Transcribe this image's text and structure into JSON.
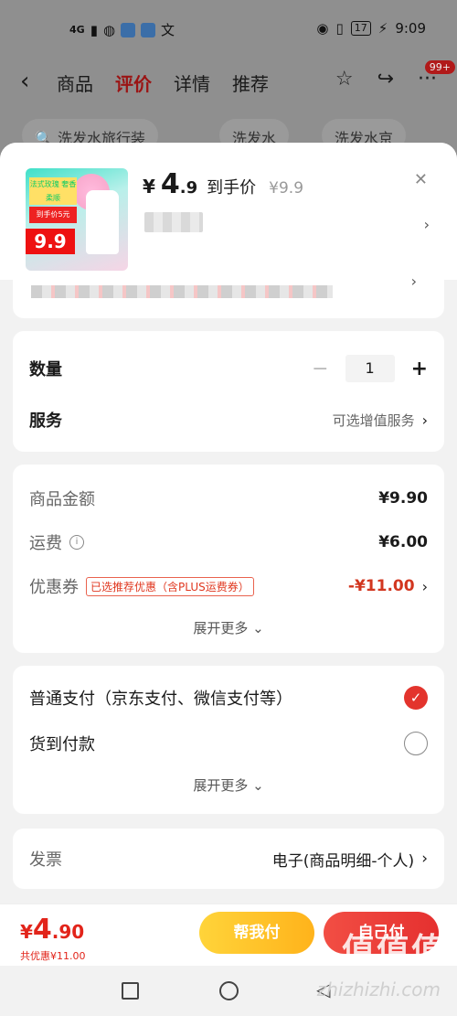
{
  "statusbar": {
    "net": "4G",
    "time": "9:09",
    "battery": "17"
  },
  "topnav": {
    "back": "‹",
    "tabs": [
      "商品",
      "评价",
      "详情",
      "推荐"
    ],
    "active_tab": "评价",
    "badge": "99+"
  },
  "search_chips": [
    "洗发水旅行装",
    "洗发水",
    "洗发水京"
  ],
  "product": {
    "currency": "¥",
    "price_int": "4",
    "price_dec": ".9",
    "price_label": "到手价",
    "original_price": "¥9.9",
    "thumb_price": "9.9",
    "thumb_tag1": "法式玫瑰 奢香柔顺",
    "thumb_tag2": "到手价5元"
  },
  "quantity": {
    "label": "数量",
    "value": "1"
  },
  "service": {
    "label": "服务",
    "value": "可选增值服务"
  },
  "summary": {
    "goods_label": "商品金额",
    "goods_value": "¥9.90",
    "shipping_label": "运费",
    "shipping_value": "¥6.00",
    "coupon_label": "优惠券",
    "coupon_tag": "已选推荐优惠（含PLUS运费券）",
    "coupon_value": "-¥11.00",
    "more": "展开更多"
  },
  "payment": {
    "option1": "普通支付（京东支付、微信支付等）",
    "option2": "货到付款",
    "more": "展开更多"
  },
  "invoice": {
    "label": "发票",
    "value": "电子(商品明细-个人)"
  },
  "bottombar": {
    "currency": "¥",
    "total_int": "4",
    "total_dec": ".90",
    "saved": "共优惠¥11.00",
    "help_pay": "帮我付",
    "self_pay": "自己付"
  },
  "watermark": {
    "main": "值值值",
    "sub": "zhizhizhi.com"
  },
  "colors": {
    "accent_red": "#e3342d",
    "yellow": "#ffc12a"
  }
}
